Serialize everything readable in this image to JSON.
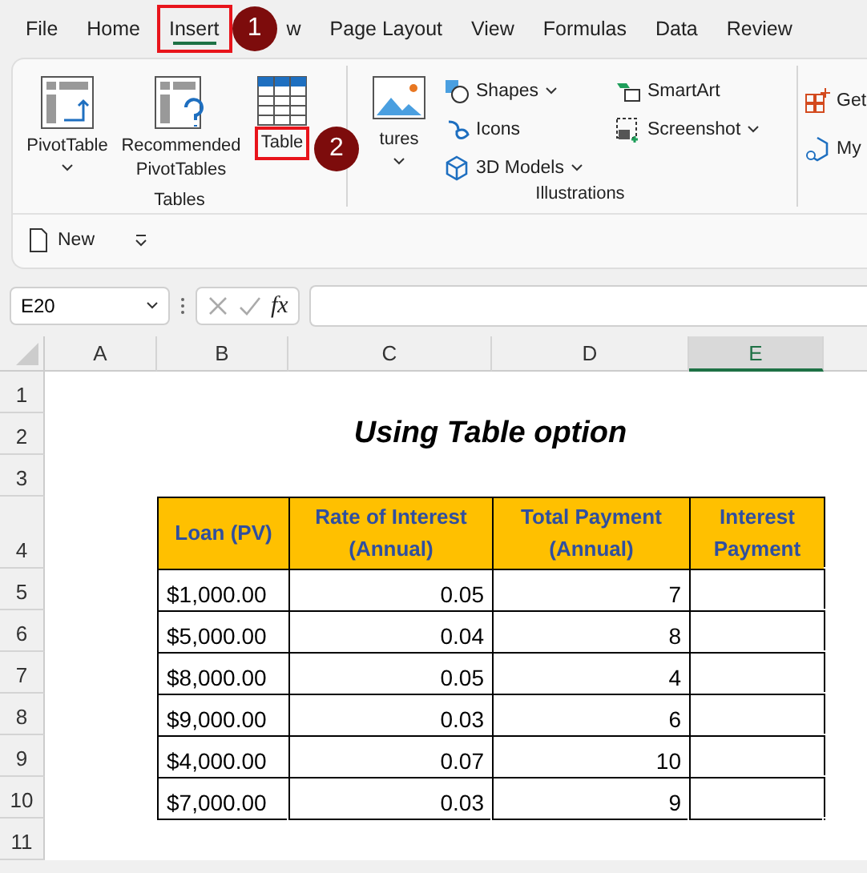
{
  "menu_tabs": [
    {
      "label": "File",
      "selected": false
    },
    {
      "label": "Home",
      "selected": false
    },
    {
      "label": "Insert",
      "selected": true,
      "callout": "1"
    },
    {
      "label": "w",
      "selected": false
    },
    {
      "label": "Page Layout",
      "selected": false
    },
    {
      "label": "View",
      "selected": false
    },
    {
      "label": "Formulas",
      "selected": false
    },
    {
      "label": "Data",
      "selected": false
    },
    {
      "label": "Review",
      "selected": false
    }
  ],
  "ribbon": {
    "groups": [
      {
        "label": "Tables",
        "large": [
          {
            "label": "PivotTable",
            "dropdown": true
          },
          {
            "label": "Recommended PivotTables",
            "dropdown": false
          },
          {
            "label": "Table",
            "dropdown": false,
            "callout": "2"
          }
        ]
      },
      {
        "label": "Illustrations",
        "large": [
          {
            "label": "tures",
            "dropdown": true
          }
        ],
        "small": [
          {
            "label": "Shapes",
            "dropdown": true
          },
          {
            "label": "Icons",
            "dropdown": false
          },
          {
            "label": "3D Models",
            "dropdown": true
          },
          {
            "label": "SmartArt",
            "dropdown": false
          },
          {
            "label": "Screenshot",
            "dropdown": true
          }
        ]
      },
      {
        "small": [
          {
            "label": "Get"
          },
          {
            "label": "My"
          }
        ]
      }
    ],
    "quick_toolbar": {
      "new_label": "New"
    }
  },
  "formula_bar": {
    "name_box": "E20",
    "function_label": "fx"
  },
  "sheet": {
    "columns": [
      {
        "label": "A",
        "selected": false
      },
      {
        "label": "B",
        "selected": false
      },
      {
        "label": "C",
        "selected": false
      },
      {
        "label": "D",
        "selected": false
      },
      {
        "label": "E",
        "selected": true
      }
    ],
    "rows": [
      "1",
      "2",
      "3",
      "4",
      "5",
      "6",
      "7",
      "8",
      "9",
      "10",
      "11"
    ],
    "title": "Using Table option",
    "table": {
      "columns": [
        "Loan (PV)",
        "Rate of Interest (Annual)",
        "Total Payment (Annual)",
        "Interest Payment"
      ],
      "rows": [
        [
          "$1,000.00",
          "0.05",
          "7"
        ],
        [
          "$5,000.00",
          "0.04",
          "8"
        ],
        [
          "$8,000.00",
          "0.05",
          "4"
        ],
        [
          "$9,000.00",
          "0.03",
          "6"
        ],
        [
          "$4,000.00",
          "0.07",
          "10"
        ],
        [
          "$7,000.00",
          "0.03",
          "9"
        ]
      ]
    }
  }
}
